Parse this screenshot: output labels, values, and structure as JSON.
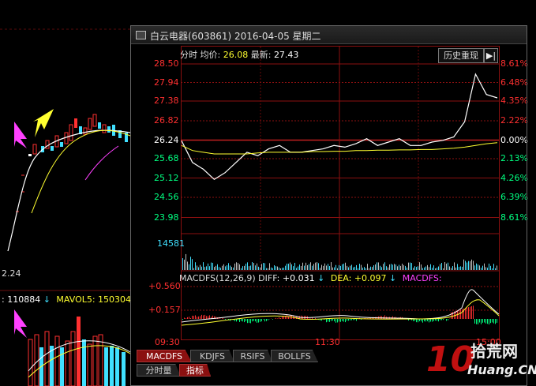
{
  "window": {
    "title": "白云电器(603861) 2016-04-05 星期二",
    "history_button": "历史重现",
    "arrow_button": "▶|"
  },
  "header": {
    "prefix": "分时",
    "avg_label": "均价:",
    "avg_value": "26.08",
    "latest_label": "最新:",
    "latest_value": "27.43"
  },
  "price_axis": {
    "left": [
      "28.50",
      "27.94",
      "27.38",
      "26.82",
      "26.24",
      "25.68",
      "25.12",
      "24.56",
      "23.98"
    ],
    "right": [
      "8.61%",
      "6.48%",
      "4.35%",
      "2.22%",
      "0.00%",
      "2.13%",
      "4.26%",
      "6.39%",
      "8.61%"
    ]
  },
  "volume_axis": {
    "max": "14581"
  },
  "macd": {
    "title": "MACDFS(12,26,9)",
    "diff_label": "DIFF:",
    "diff_value": "+0.031",
    "dea_label": "DEA:",
    "dea_value": "+0.097",
    "macd_label": "MACDFS:",
    "axis_top": "+0.560",
    "axis_mid": "+0.157"
  },
  "time_axis": [
    "09:30",
    "11:30",
    "15:00"
  ],
  "tabs": [
    "MACDFS",
    "KDJFS",
    "RSIFS",
    "BOLLFS"
  ],
  "bottom_tabs": [
    "分时量",
    "指标"
  ],
  "background_chart": {
    "price_label": "2.24",
    "volume_label_1": ": 110884",
    "volume_label_2": "MAVOL5: 150304"
  },
  "watermark": {
    "number": "10",
    "site": "Huang.CN",
    "chars": "拾荒网"
  },
  "colors": {
    "up": "#ff3030",
    "down": "#00ff80",
    "grid": "#8b1010",
    "price_line": "#ffffff",
    "avg_line": "#ffff00",
    "cyan": "#40e0ff",
    "magenta": "#ff40ff"
  },
  "chart_data": {
    "type": "line",
    "x_labels": [
      "09:30",
      "11:30",
      "15:00"
    ],
    "ylim": [
      23.98,
      28.5
    ],
    "series": [
      {
        "values": [
          26.24,
          25.6,
          25.4,
          25.1,
          25.3,
          25.6,
          25.9,
          25.8,
          26.0,
          26.1,
          25.9,
          25.9,
          25.95,
          26.0,
          26.1,
          26.05,
          26.15,
          26.3,
          26.1,
          26.2,
          26.3,
          26.1,
          26.1,
          26.2,
          26.25,
          26.35,
          26.8,
          28.2,
          27.6,
          27.5
        ]
      },
      {
        "values": [
          26.1,
          25.95,
          25.9,
          25.85,
          25.85,
          25.85,
          25.85,
          25.88,
          25.9,
          25.9,
          25.9,
          25.9,
          25.92,
          25.92,
          25.93,
          25.93,
          25.95,
          25.95,
          25.96,
          25.96,
          25.97,
          25.97,
          25.98,
          25.98,
          26.0,
          26.02,
          26.05,
          26.1,
          26.15,
          26.18
        ]
      }
    ]
  }
}
